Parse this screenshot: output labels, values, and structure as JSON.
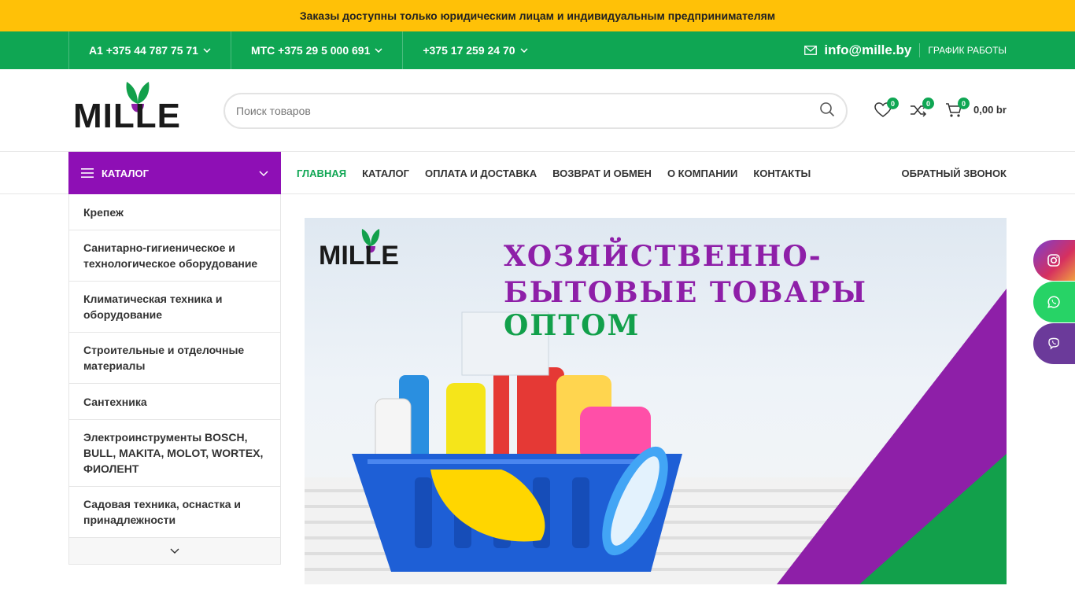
{
  "notice": {
    "text": "Заказы доступны только юридическим лицам и индивидуальным предпринимателям"
  },
  "topbar": {
    "phones": [
      {
        "label": "А1 +375 44 787 75 71"
      },
      {
        "label": "МТС +375 29 5 000 691"
      },
      {
        "label": "+375 17 259 24 70"
      }
    ],
    "email": "info@mille.by",
    "schedule": "ГРАФИК РАБОТЫ"
  },
  "header": {
    "logo_text": "MILLE",
    "search_placeholder": "Поиск товаров",
    "wishlist_count": "0",
    "compare_count": "0",
    "cart_count": "0",
    "cart_total": "0,00 br"
  },
  "nav": {
    "catalog_button": "КАТАЛОГ",
    "items": [
      {
        "label": "ГЛАВНАЯ"
      },
      {
        "label": "КАТАЛОГ"
      },
      {
        "label": "ОПЛАТА И ДОСТАВКА"
      },
      {
        "label": "ВОЗВРАТ И ОБМЕН"
      },
      {
        "label": "О КОМПАНИИ"
      },
      {
        "label": "КОНТАКТЫ"
      }
    ],
    "callback": "ОБРАТНЫЙ ЗВОНОК"
  },
  "categories": [
    {
      "label": "Крепеж"
    },
    {
      "label": "Санитарно-гигиеническое и технологическое оборудование"
    },
    {
      "label": "Климатическая техника и оборудование"
    },
    {
      "label": "Строительные и отделочные материалы"
    },
    {
      "label": "Сантехника"
    },
    {
      "label": "Электроинструменты BOSCH, BULL, MAKITA, MOLOT, WORTEX, ФИОЛЕНТ"
    },
    {
      "label": "Садовая техника, оснастка и принадлежности"
    }
  ],
  "banner": {
    "line1": "ХОЗЯЙСТВЕННО-",
    "line2_a": "БЫТОВЫЕ ТОВАРЫ",
    "line2_b": "ОПТОМ",
    "logo_text": "MILLE"
  },
  "colors": {
    "accent_green": "#0fa653",
    "accent_purple": "#8e0fb5",
    "notice_yellow": "#ffc107"
  },
  "social": [
    "instagram-icon",
    "whatsapp-icon",
    "viber-icon"
  ]
}
